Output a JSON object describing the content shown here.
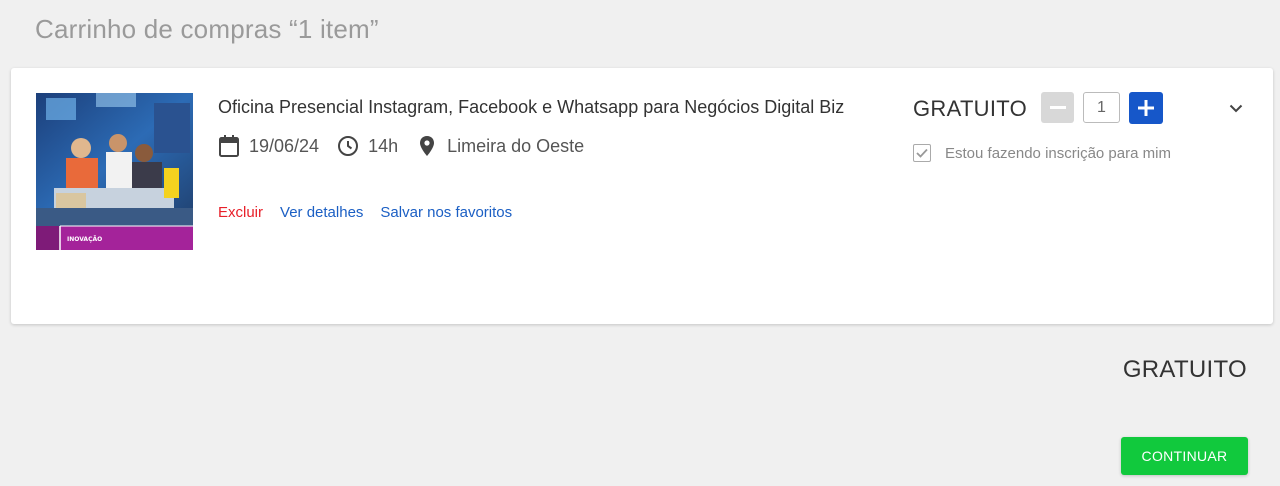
{
  "header": {
    "title": "Carrinho de compras “1 item”"
  },
  "cart_item": {
    "thumbnail_caption": "INOVAÇÃO",
    "title": "Oficina Presencial Instagram, Facebook e Whatsapp para Negócios Digital Biz",
    "date": "19/06/24",
    "time": "14h",
    "location": "Limeira do Oeste",
    "links": {
      "remove": "Excluir",
      "details": "Ver detalhes",
      "favorite": "Salvar nos favoritos"
    },
    "price": "GRATUITO",
    "quantity": "1",
    "self_registration_label": "Estou fazendo inscrição para mim",
    "self_registration_checked": true
  },
  "summary": {
    "total": "GRATUITO",
    "continue_label": "CONTINUAR"
  },
  "colors": {
    "accent_blue": "#1657c9",
    "link_blue": "#1b5fc4",
    "remove_red": "#e8202a",
    "continue_green": "#11c93d",
    "thumb_purple": "#a4239a"
  },
  "icons": {
    "date": "calendar-icon",
    "time": "clock-icon",
    "location": "map-pin-icon",
    "expand": "chevron-down-icon",
    "decrease": "minus-icon",
    "increase": "plus-icon",
    "checkbox": "check-icon"
  }
}
